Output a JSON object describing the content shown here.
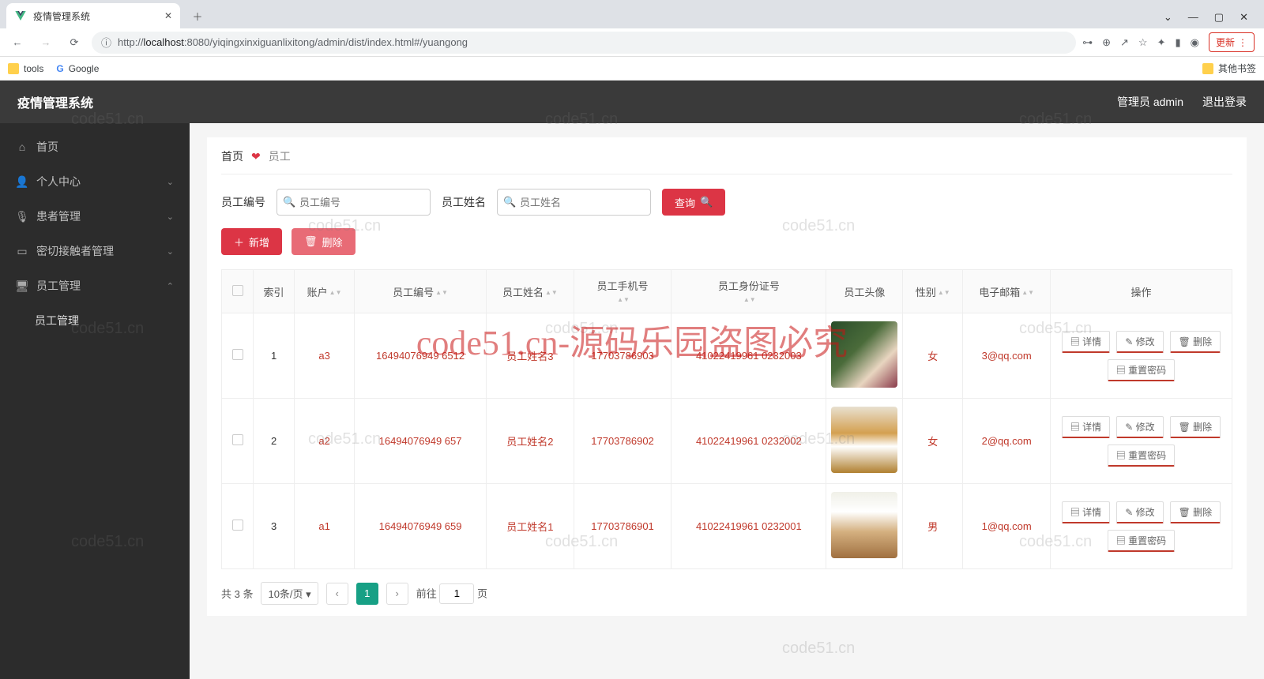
{
  "browser": {
    "tab_title": "疫情管理系统",
    "url_prefix": "http://",
    "url_host": "localhost",
    "url_path": ":8080/yiqingxinxiguanlixitong/admin/dist/index.html#/yuangong",
    "update_label": "更新",
    "bookmarks": {
      "tools": "tools",
      "google": "Google",
      "other": "其他书签"
    }
  },
  "header": {
    "title": "疫情管理系统",
    "user": "管理员 admin",
    "logout": "退出登录"
  },
  "sidebar": {
    "home": "首页",
    "personal": "个人中心",
    "patient": "患者管理",
    "contact": "密切接触者管理",
    "staff": "员工管理",
    "staff_sub": "员工管理"
  },
  "breadcrumb": {
    "home": "首页",
    "current": "员工"
  },
  "search": {
    "label_id": "员工编号",
    "ph_id": "员工编号",
    "label_name": "员工姓名",
    "ph_name": "员工姓名",
    "query": "查询"
  },
  "actions": {
    "add": "新增",
    "delete": "删除"
  },
  "columns": {
    "index": "索引",
    "account": "账户",
    "emp_id": "员工编号",
    "emp_name": "员工姓名",
    "phone": "员工手机号",
    "idcard": "员工身份证号",
    "avatar": "员工头像",
    "gender": "性别",
    "email": "电子邮箱",
    "ops": "操作"
  },
  "rows": [
    {
      "index": "1",
      "account": "a3",
      "emp_id": "16494076949 6512",
      "emp_name": "员工姓名3",
      "phone": "17703786903",
      "idcard": "41022419961 0232003",
      "gender": "女",
      "email": "3@qq.com"
    },
    {
      "index": "2",
      "account": "a2",
      "emp_id": "16494076949 657",
      "emp_name": "员工姓名2",
      "phone": "17703786902",
      "idcard": "41022419961 0232002",
      "gender": "女",
      "email": "2@qq.com"
    },
    {
      "index": "3",
      "account": "a1",
      "emp_id": "16494076949 659",
      "emp_name": "员工姓名1",
      "phone": "17703786901",
      "idcard": "41022419961 0232001",
      "gender": "男",
      "email": "1@qq.com"
    }
  ],
  "ops": {
    "detail": "详情",
    "edit": "修改",
    "delete": "删除",
    "reset": "重置密码"
  },
  "pagination": {
    "total": "共 3 条",
    "page_size": "10条/页",
    "goto": "前往",
    "page": "1",
    "unit": "页"
  },
  "watermarks": {
    "small": "code51.cn",
    "big": "code51.cn-源码乐园盗图必究"
  }
}
